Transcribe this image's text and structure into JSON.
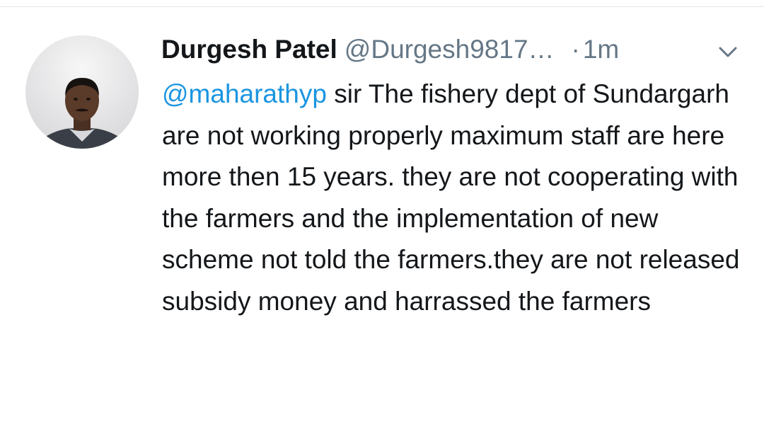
{
  "tweet": {
    "author": {
      "display_name": "Durgesh Patel",
      "handle": "@Durgesh9817…",
      "avatar_icon": "profile-photo"
    },
    "separator": "·",
    "timestamp": "1m",
    "menu_icon": "chevron-down-icon",
    "mention": "@maharathyp",
    "text_after_mention": " sir The fishery dept of Sundargarh are not working properly maximum staff are here more then 15 years. they are not cooperating with the farmers and the implementation of new scheme not told the farmers.they are not released subsidy money and harrassed the farmers"
  },
  "colors": {
    "text": "#14171a",
    "secondary": "#657786",
    "link": "#1b95e0",
    "divider": "#e1e8ed"
  }
}
